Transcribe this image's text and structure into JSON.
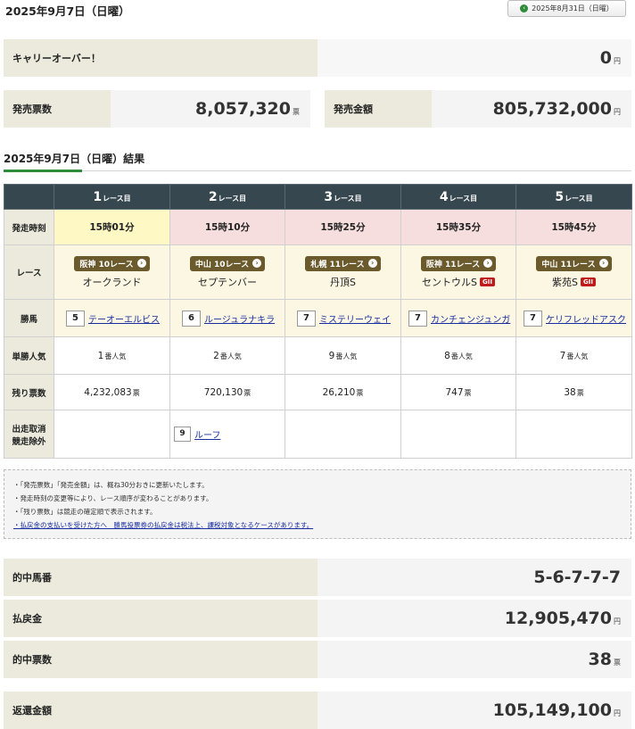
{
  "header": {
    "date_title": "2025年9月7日（日曜）",
    "prev_button_label": "2025年8月31日（日曜）",
    "prev_icon": "chevron-left-icon"
  },
  "summary": {
    "carryover_label": "キャリーオーバー！",
    "carryover_value": "0",
    "carryover_unit": "円",
    "sold_tickets_label": "発売票数",
    "sold_tickets_value": "8,057,320",
    "sold_tickets_unit": "票",
    "sold_amount_label": "発売金額",
    "sold_amount_value": "805,732,000",
    "sold_amount_unit": "円"
  },
  "results": {
    "title": "2025年9月7日（日曜）結果",
    "row_labels": {
      "start_time": "発走時刻",
      "race": "レース",
      "winner": "勝馬",
      "popularity": "単勝人気",
      "remaining": "残り票数",
      "scratch_line1": "出走取消",
      "scratch_line2": "競走除外"
    },
    "header_suffix": "レース目",
    "popularity_unit": "番人気",
    "remaining_unit": "票",
    "races": [
      {
        "num": "1",
        "time": "15時01分",
        "venue": "阪神 10レース",
        "name": "オークランド",
        "grade": "",
        "winner_num": "5",
        "winner": "テーオーエルビス",
        "popularity": "1",
        "remaining": "4,232,083",
        "scratch_num": "",
        "scratch": ""
      },
      {
        "num": "2",
        "time": "15時10分",
        "venue": "中山 10レース",
        "name": "セプテンバー",
        "grade": "",
        "winner_num": "6",
        "winner": "ルージュラナキラ",
        "popularity": "2",
        "remaining": "720,130",
        "scratch_num": "9",
        "scratch": "ルーフ"
      },
      {
        "num": "3",
        "time": "15時25分",
        "venue": "札幌 11レース",
        "name": "丹頂S",
        "grade": "",
        "winner_num": "7",
        "winner": "ミステリーウェイ",
        "popularity": "9",
        "remaining": "26,210",
        "scratch_num": "",
        "scratch": ""
      },
      {
        "num": "4",
        "time": "15時35分",
        "venue": "阪神 11レース",
        "name": "セントウルS",
        "grade": "GII",
        "winner_num": "7",
        "winner": "カンチェンジュンガ",
        "popularity": "8",
        "remaining": "747",
        "scratch_num": "",
        "scratch": ""
      },
      {
        "num": "5",
        "time": "15時45分",
        "venue": "中山 11レース",
        "name": "紫苑S",
        "grade": "GII",
        "winner_num": "7",
        "winner": "ケリフレッドアスク",
        "popularity": "7",
        "remaining": "38",
        "scratch_num": "",
        "scratch": ""
      }
    ]
  },
  "notes": [
    "「発売票数」「発売金額」は、概ね30分おきに更新いたします。",
    "発走時刻の変更等により、レース順序が変わることがあります。",
    "「残り票数」は競走の確定順で表示されます。"
  ],
  "notes_link": "払戻金の支払いを受けた方へ　勝馬投票券の払戻金は税法上、課税対象となるケースがあります。",
  "payout": {
    "winning_numbers_label": "的中馬番",
    "winning_numbers_value": "5-6-7-7-7",
    "payout_label": "払戻金",
    "payout_value": "12,905,470",
    "payout_unit": "円",
    "winning_tickets_label": "的中票数",
    "winning_tickets_value": "38",
    "winning_tickets_unit": "票",
    "refund_label": "返還金額",
    "refund_value": "105,149,100",
    "refund_unit": "円"
  }
}
